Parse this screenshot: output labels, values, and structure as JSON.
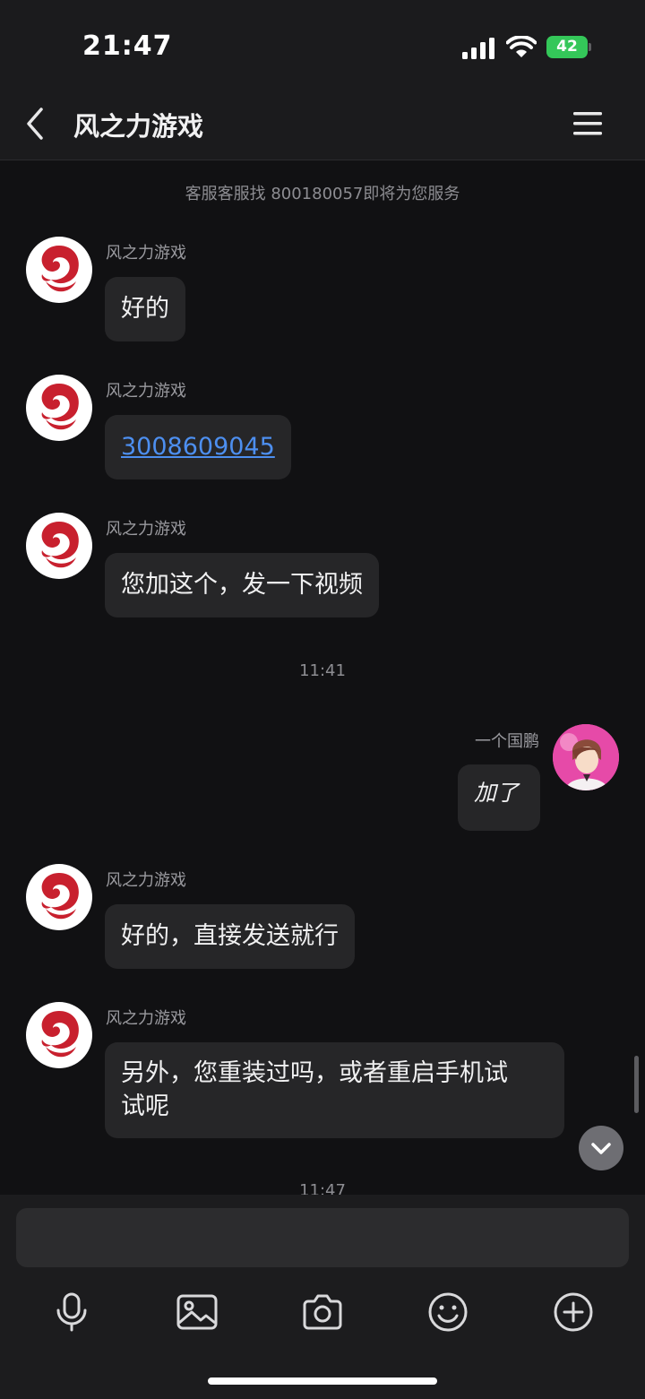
{
  "status": {
    "time": "21:47",
    "battery": "42"
  },
  "header": {
    "title": "风之力游戏"
  },
  "notice": "客服客服找 800180057即将为您服务",
  "messages": [
    {
      "sender": "风之力游戏",
      "text": "好的"
    },
    {
      "sender": "风之力游戏",
      "text": "3008609045"
    },
    {
      "sender": "风之力游戏",
      "text": "您加这个，发一下视频"
    },
    {
      "sender": "一个国鹏",
      "text": "加了"
    },
    {
      "sender": "风之力游戏",
      "text": "好的，直接发送就行"
    },
    {
      "sender": "风之力游戏",
      "text_line1": "另外，您重装过吗，或者重启手机试",
      "text_line2": "试呢"
    }
  ],
  "timestamps": [
    "11:41",
    "11:47"
  ],
  "input": {
    "placeholder": ""
  },
  "toolbar": [
    "microphone-icon",
    "image-icon",
    "camera-icon",
    "emoji-icon",
    "plus-icon"
  ],
  "colors": {
    "accent_link": "#4d8ff0",
    "battery": "#34c759",
    "bubble": "#262628",
    "background": "#111113"
  }
}
